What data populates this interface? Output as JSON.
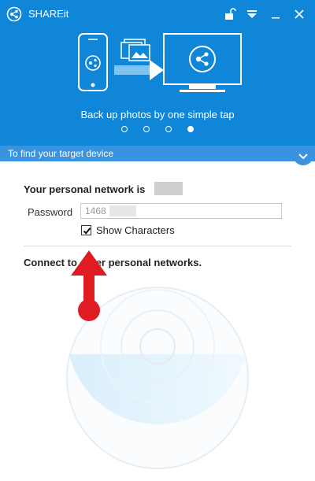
{
  "window": {
    "title": "SHAREit"
  },
  "hero": {
    "tagline": "Back up photos by one simple tap",
    "pagination": {
      "count": 4,
      "active_index": 3
    }
  },
  "findbar": {
    "label": "To find your target device"
  },
  "network": {
    "title": "Your personal network is",
    "password_label": "Password",
    "password_value": "1468",
    "show_characters_label": "Show Characters",
    "show_characters_checked": true,
    "connect_label": "Connect to other personal networks."
  },
  "colors": {
    "brand_blue": "#0f86d8",
    "bar_blue": "#3a93df",
    "annotation_red": "#e01b22"
  },
  "icons": [
    "shareit-logo-icon",
    "unlock-icon",
    "dropdown-menu-icon",
    "minimize-icon",
    "close-icon",
    "chevron-down-icon"
  ]
}
